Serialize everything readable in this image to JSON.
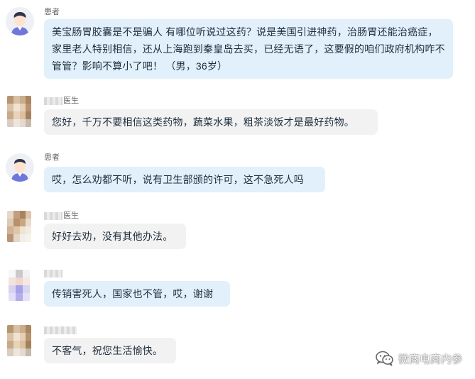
{
  "messages": [
    {
      "role": "patient",
      "name": "患者",
      "text": "美宝肠胃胶囊是不是骗人 有哪位听说过这药？说是美国引进神药，治肠胃还能治癌症，家里老人特别相信，还从上海跑到秦皇岛去买，已经无语了，这要假的咱们政府机构咋不管管？影响不算小了吧！ （男，36岁）"
    },
    {
      "role": "doctor",
      "name": "医生",
      "text": "您好，千万不要相信这类药物，蔬菜水果，粗茶淡饭才是最好药物。"
    },
    {
      "role": "patient",
      "name": "患者",
      "text": "哎，怎么劝都不听，说有卫生部颁的许可，这不急死人吗"
    },
    {
      "role": "doctor",
      "name": "医生",
      "text": "好好去劝，没有其他办法。"
    },
    {
      "role": "patient",
      "name": "",
      "text": "传销害死人，国家也不管，哎，谢谢"
    },
    {
      "role": "doctor",
      "name": "",
      "text": "不客气，祝您生活愉快。"
    }
  ],
  "watermark": {
    "icon": "wechat-icon",
    "text": "微商电商内参"
  },
  "colors": {
    "patient_bubble": "#e1f0fb",
    "doctor_bubble": "#f2f2f2"
  }
}
